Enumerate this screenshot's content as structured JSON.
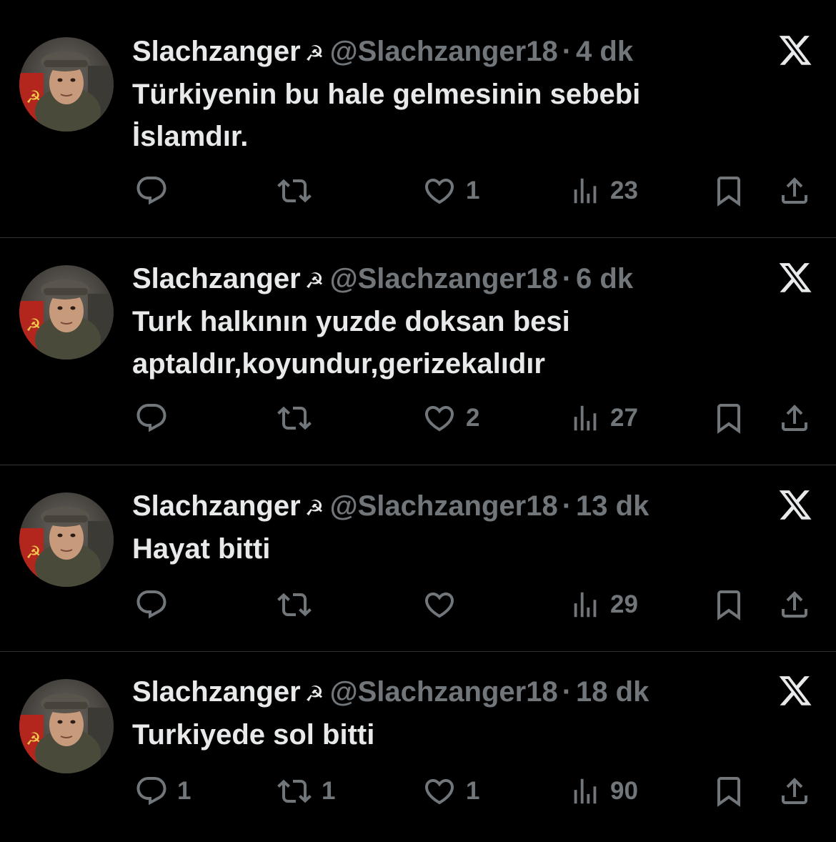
{
  "colors": {
    "background": "#000000",
    "text_primary": "#e7e9ea",
    "text_secondary": "#71767b",
    "divider": "#2f3336"
  },
  "icons": {
    "badge": "hammer-sickle-icon",
    "platform": "x-logo-icon",
    "reply": "reply-icon",
    "repost": "repost-icon",
    "like": "heart-icon",
    "views": "views-icon",
    "bookmark": "bookmark-icon",
    "share": "share-icon"
  },
  "badge_glyph": "☭",
  "tweets": [
    {
      "name": "Slachzanger",
      "handle": "@Slachzanger18",
      "separator": "·",
      "time": "4 dk",
      "text_lines": [
        "Türkiyenin bu hale gelmesinin sebebi",
        "İslamdır."
      ],
      "replies": "",
      "reposts": "",
      "likes": "1",
      "views": "23"
    },
    {
      "name": "Slachzanger",
      "handle": "@Slachzanger18",
      "separator": "·",
      "time": "6 dk",
      "text_lines": [
        "Turk halkının yuzde doksan besi",
        "aptaldır,koyundur,gerizekalıdır"
      ],
      "replies": "",
      "reposts": "",
      "likes": "2",
      "views": "27"
    },
    {
      "name": "Slachzanger",
      "handle": "@Slachzanger18",
      "separator": "·",
      "time": "13 dk",
      "text_lines": [
        "Hayat bitti"
      ],
      "replies": "",
      "reposts": "",
      "likes": "",
      "views": "29"
    },
    {
      "name": "Slachzanger",
      "handle": "@Slachzanger18",
      "separator": "·",
      "time": "18 dk",
      "text_lines": [
        "Turkiyede sol bitti"
      ],
      "replies": "1",
      "reposts": "1",
      "likes": "1",
      "views": "90"
    }
  ]
}
